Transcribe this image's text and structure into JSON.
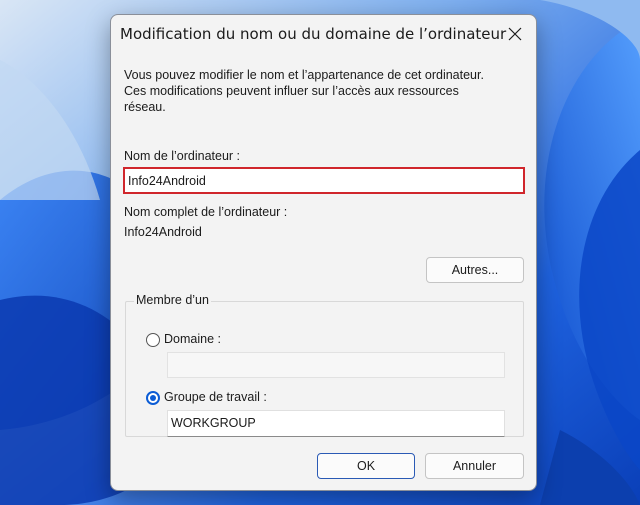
{
  "dialog": {
    "title": "Modification du nom ou du domaine de l’ordinateur",
    "description_lines": [
      "Vous pouvez modifier le nom et l’appartenance de cet ordinateur.",
      "Ces modifications peuvent influer sur l’accès aux ressources",
      "réseau."
    ],
    "computer_name_label": "Nom de l’ordinateur :",
    "computer_name_value": "Info24Android",
    "full_name_label": "Nom complet de l’ordinateur :",
    "full_name_value": "Info24Android",
    "more_button": "Autres...",
    "member_of": {
      "legend": "Membre d’un",
      "domain_label": "Domaine :",
      "domain_value": "",
      "domain_selected": false,
      "workgroup_label": "Groupe de travail :",
      "workgroup_value": "WORKGROUP",
      "workgroup_selected": true
    },
    "ok_button": "OK",
    "cancel_button": "Annuler"
  },
  "icons": {
    "close": "close-icon"
  },
  "colors": {
    "highlight_border": "#d0262c",
    "radio_accent": "#0b5cd5",
    "primary_button_border": "#2a5ab5",
    "wallpaper": "#0a4fd6"
  }
}
